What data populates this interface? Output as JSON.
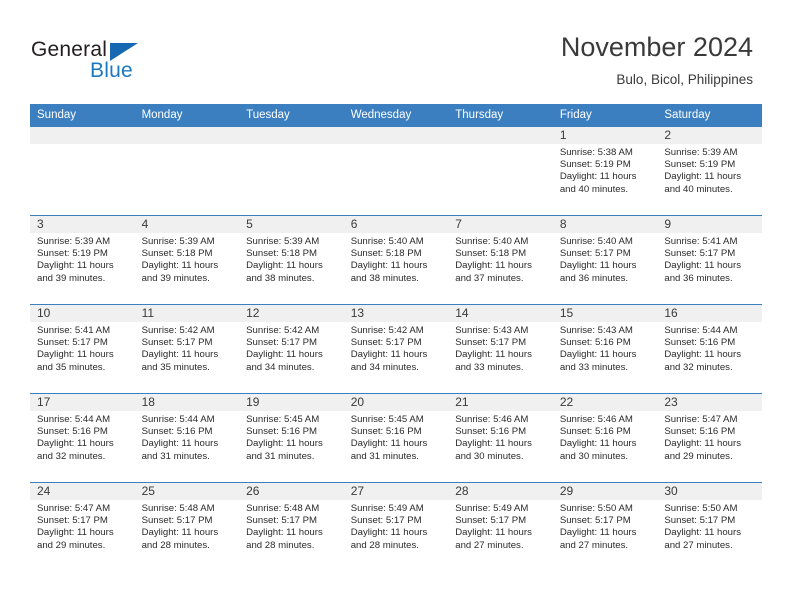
{
  "logo": {
    "word_one": "General",
    "word_two": "Blue",
    "triangle_icon": "triangle-icon",
    "brand_blue": "#1c79c0"
  },
  "header": {
    "month_title": "November 2024",
    "location": "Bulo, Bicol, Philippines"
  },
  "theme": {
    "header_blue": "#3c7fc1",
    "daynum_band": "#f0f0f0",
    "text": "#2b2b2b"
  },
  "weekday_headers": [
    "Sunday",
    "Monday",
    "Tuesday",
    "Wednesday",
    "Thursday",
    "Friday",
    "Saturday"
  ],
  "weeks": [
    [
      {
        "day": "",
        "sunrise": "",
        "sunset": "",
        "daylight_a": "",
        "daylight_b": ""
      },
      {
        "day": "",
        "sunrise": "",
        "sunset": "",
        "daylight_a": "",
        "daylight_b": ""
      },
      {
        "day": "",
        "sunrise": "",
        "sunset": "",
        "daylight_a": "",
        "daylight_b": ""
      },
      {
        "day": "",
        "sunrise": "",
        "sunset": "",
        "daylight_a": "",
        "daylight_b": ""
      },
      {
        "day": "",
        "sunrise": "",
        "sunset": "",
        "daylight_a": "",
        "daylight_b": ""
      },
      {
        "day": "1",
        "sunrise": "Sunrise: 5:38 AM",
        "sunset": "Sunset: 5:19 PM",
        "daylight_a": "Daylight: 11 hours",
        "daylight_b": "and 40 minutes."
      },
      {
        "day": "2",
        "sunrise": "Sunrise: 5:39 AM",
        "sunset": "Sunset: 5:19 PM",
        "daylight_a": "Daylight: 11 hours",
        "daylight_b": "and 40 minutes."
      }
    ],
    [
      {
        "day": "3",
        "sunrise": "Sunrise: 5:39 AM",
        "sunset": "Sunset: 5:19 PM",
        "daylight_a": "Daylight: 11 hours",
        "daylight_b": "and 39 minutes."
      },
      {
        "day": "4",
        "sunrise": "Sunrise: 5:39 AM",
        "sunset": "Sunset: 5:18 PM",
        "daylight_a": "Daylight: 11 hours",
        "daylight_b": "and 39 minutes."
      },
      {
        "day": "5",
        "sunrise": "Sunrise: 5:39 AM",
        "sunset": "Sunset: 5:18 PM",
        "daylight_a": "Daylight: 11 hours",
        "daylight_b": "and 38 minutes."
      },
      {
        "day": "6",
        "sunrise": "Sunrise: 5:40 AM",
        "sunset": "Sunset: 5:18 PM",
        "daylight_a": "Daylight: 11 hours",
        "daylight_b": "and 38 minutes."
      },
      {
        "day": "7",
        "sunrise": "Sunrise: 5:40 AM",
        "sunset": "Sunset: 5:18 PM",
        "daylight_a": "Daylight: 11 hours",
        "daylight_b": "and 37 minutes."
      },
      {
        "day": "8",
        "sunrise": "Sunrise: 5:40 AM",
        "sunset": "Sunset: 5:17 PM",
        "daylight_a": "Daylight: 11 hours",
        "daylight_b": "and 36 minutes."
      },
      {
        "day": "9",
        "sunrise": "Sunrise: 5:41 AM",
        "sunset": "Sunset: 5:17 PM",
        "daylight_a": "Daylight: 11 hours",
        "daylight_b": "and 36 minutes."
      }
    ],
    [
      {
        "day": "10",
        "sunrise": "Sunrise: 5:41 AM",
        "sunset": "Sunset: 5:17 PM",
        "daylight_a": "Daylight: 11 hours",
        "daylight_b": "and 35 minutes."
      },
      {
        "day": "11",
        "sunrise": "Sunrise: 5:42 AM",
        "sunset": "Sunset: 5:17 PM",
        "daylight_a": "Daylight: 11 hours",
        "daylight_b": "and 35 minutes."
      },
      {
        "day": "12",
        "sunrise": "Sunrise: 5:42 AM",
        "sunset": "Sunset: 5:17 PM",
        "daylight_a": "Daylight: 11 hours",
        "daylight_b": "and 34 minutes."
      },
      {
        "day": "13",
        "sunrise": "Sunrise: 5:42 AM",
        "sunset": "Sunset: 5:17 PM",
        "daylight_a": "Daylight: 11 hours",
        "daylight_b": "and 34 minutes."
      },
      {
        "day": "14",
        "sunrise": "Sunrise: 5:43 AM",
        "sunset": "Sunset: 5:17 PM",
        "daylight_a": "Daylight: 11 hours",
        "daylight_b": "and 33 minutes."
      },
      {
        "day": "15",
        "sunrise": "Sunrise: 5:43 AM",
        "sunset": "Sunset: 5:16 PM",
        "daylight_a": "Daylight: 11 hours",
        "daylight_b": "and 33 minutes."
      },
      {
        "day": "16",
        "sunrise": "Sunrise: 5:44 AM",
        "sunset": "Sunset: 5:16 PM",
        "daylight_a": "Daylight: 11 hours",
        "daylight_b": "and 32 minutes."
      }
    ],
    [
      {
        "day": "17",
        "sunrise": "Sunrise: 5:44 AM",
        "sunset": "Sunset: 5:16 PM",
        "daylight_a": "Daylight: 11 hours",
        "daylight_b": "and 32 minutes."
      },
      {
        "day": "18",
        "sunrise": "Sunrise: 5:44 AM",
        "sunset": "Sunset: 5:16 PM",
        "daylight_a": "Daylight: 11 hours",
        "daylight_b": "and 31 minutes."
      },
      {
        "day": "19",
        "sunrise": "Sunrise: 5:45 AM",
        "sunset": "Sunset: 5:16 PM",
        "daylight_a": "Daylight: 11 hours",
        "daylight_b": "and 31 minutes."
      },
      {
        "day": "20",
        "sunrise": "Sunrise: 5:45 AM",
        "sunset": "Sunset: 5:16 PM",
        "daylight_a": "Daylight: 11 hours",
        "daylight_b": "and 31 minutes."
      },
      {
        "day": "21",
        "sunrise": "Sunrise: 5:46 AM",
        "sunset": "Sunset: 5:16 PM",
        "daylight_a": "Daylight: 11 hours",
        "daylight_b": "and 30 minutes."
      },
      {
        "day": "22",
        "sunrise": "Sunrise: 5:46 AM",
        "sunset": "Sunset: 5:16 PM",
        "daylight_a": "Daylight: 11 hours",
        "daylight_b": "and 30 minutes."
      },
      {
        "day": "23",
        "sunrise": "Sunrise: 5:47 AM",
        "sunset": "Sunset: 5:16 PM",
        "daylight_a": "Daylight: 11 hours",
        "daylight_b": "and 29 minutes."
      }
    ],
    [
      {
        "day": "24",
        "sunrise": "Sunrise: 5:47 AM",
        "sunset": "Sunset: 5:17 PM",
        "daylight_a": "Daylight: 11 hours",
        "daylight_b": "and 29 minutes."
      },
      {
        "day": "25",
        "sunrise": "Sunrise: 5:48 AM",
        "sunset": "Sunset: 5:17 PM",
        "daylight_a": "Daylight: 11 hours",
        "daylight_b": "and 28 minutes."
      },
      {
        "day": "26",
        "sunrise": "Sunrise: 5:48 AM",
        "sunset": "Sunset: 5:17 PM",
        "daylight_a": "Daylight: 11 hours",
        "daylight_b": "and 28 minutes."
      },
      {
        "day": "27",
        "sunrise": "Sunrise: 5:49 AM",
        "sunset": "Sunset: 5:17 PM",
        "daylight_a": "Daylight: 11 hours",
        "daylight_b": "and 28 minutes."
      },
      {
        "day": "28",
        "sunrise": "Sunrise: 5:49 AM",
        "sunset": "Sunset: 5:17 PM",
        "daylight_a": "Daylight: 11 hours",
        "daylight_b": "and 27 minutes."
      },
      {
        "day": "29",
        "sunrise": "Sunrise: 5:50 AM",
        "sunset": "Sunset: 5:17 PM",
        "daylight_a": "Daylight: 11 hours",
        "daylight_b": "and 27 minutes."
      },
      {
        "day": "30",
        "sunrise": "Sunrise: 5:50 AM",
        "sunset": "Sunset: 5:17 PM",
        "daylight_a": "Daylight: 11 hours",
        "daylight_b": "and 27 minutes."
      }
    ]
  ]
}
